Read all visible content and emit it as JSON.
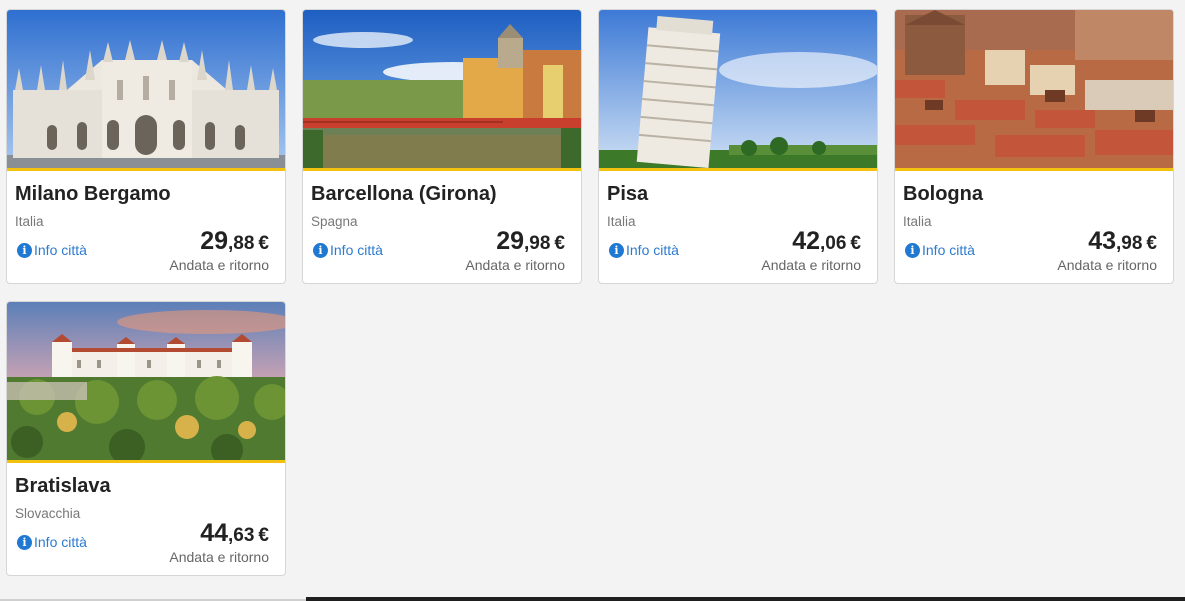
{
  "info_label": "Info città",
  "trip_label": "Andata e ritorno",
  "currency": "€",
  "accent_color": "#f2c20f",
  "destinations": [
    {
      "city": "Milano Bergamo",
      "country": "Italia",
      "price_int": "29",
      "price_dec": ",88",
      "image": "milan-cathedral"
    },
    {
      "city": "Barcellona (Girona)",
      "country": "Spagna",
      "price_int": "29",
      "price_dec": ",98",
      "image": "girona-river-houses"
    },
    {
      "city": "Pisa",
      "country": "Italia",
      "price_int": "42",
      "price_dec": ",06",
      "image": "leaning-tower-of-pisa"
    },
    {
      "city": "Bologna",
      "country": "Italia",
      "price_int": "43",
      "price_dec": ",98",
      "image": "bologna-rooftops"
    },
    {
      "city": "Bratislava",
      "country": "Slovacchia",
      "price_int": "44",
      "price_dec": ",63",
      "image": "bratislava-castle"
    }
  ]
}
